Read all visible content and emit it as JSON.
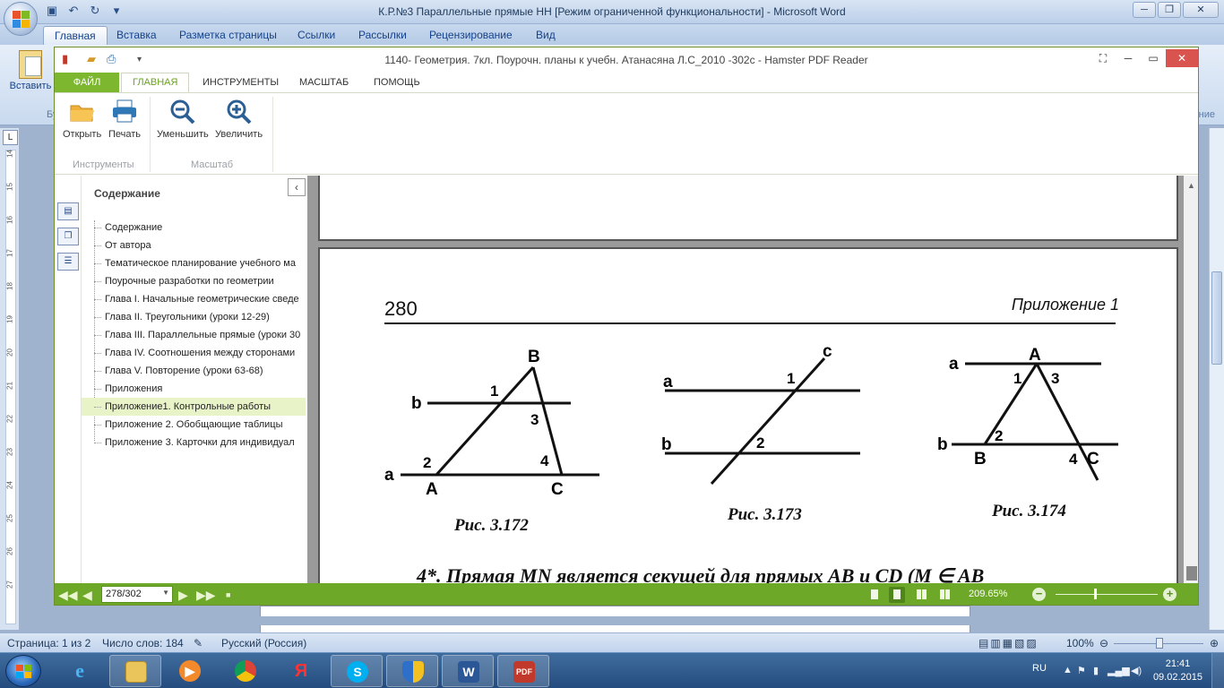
{
  "word": {
    "title": "К.Р.№3 Параллельные прямые НН [Режим ограниченной функциональности] - Microsoft Word",
    "tabs": [
      "Главная",
      "Вставка",
      "Разметка страницы",
      "Ссылки",
      "Рассылки",
      "Рецензирование",
      "Вид"
    ],
    "paste_label": "Вставить",
    "ribbon_group_left": "Бу",
    "ribbon_group_right": "ние",
    "ruler_numbers": [
      "14",
      "15",
      "16",
      "17",
      "18",
      "19",
      "20",
      "21",
      "22",
      "23",
      "24",
      "25",
      "26",
      "27"
    ],
    "status": {
      "page": "Страница: 1 из 2",
      "words": "Число слов: 184",
      "language": "Русский (Россия)",
      "zoom": "100%"
    }
  },
  "pdf": {
    "title": "1140- Геометрия. 7кл. Поурочн. планы к учебн. Атанасяна Л.С_2010 -302с - Hamster PDF Reader",
    "tabs": {
      "file": "ФАЙЛ",
      "home": "ГЛАВНАЯ",
      "tools": "ИНСТРУМЕНТЫ",
      "scale": "МАСШТАБ",
      "help": "ПОМОЩЬ"
    },
    "ribbon": {
      "open": "Открыть",
      "print": "Печать",
      "zoom_out": "Уменьшить",
      "zoom_in": "Увеличить",
      "group_tools": "Инструменты",
      "group_scale": "Масштаб"
    },
    "toc": {
      "heading": "Содержание",
      "items": [
        "Содержание",
        "От автора",
        "Тематическое планирование учебного ма",
        "Поурочные разработки по геометрии",
        "Глава I. Начальные геометрические сведе",
        "Глава II. Треугольники (уроки 12-29)",
        "Глава III. Параллельные прямые (уроки 30",
        "Глава IV. Соотношения между сторонами",
        "Глава V. Повторение (уроки 63-68)",
        "Приложения",
        "Приложение1. Контрольные работы",
        "Приложение 2. Обобщающие таблицы",
        "Приложение 3. Карточки для индивидуал"
      ],
      "selected_index": 10
    },
    "page": {
      "number": "280",
      "appendix": "Приложение 1",
      "fig1": {
        "caption": "Рис. 3.172",
        "labels": [
          "B",
          "b",
          "1",
          "3",
          "a",
          "2",
          "4",
          "A",
          "C"
        ]
      },
      "fig2": {
        "caption": "Рис. 3.173",
        "labels": [
          "c",
          "a",
          "1",
          "b",
          "2"
        ]
      },
      "fig3": {
        "caption": "Рис. 3.174",
        "labels": [
          "a",
          "A",
          "1",
          "3",
          "b",
          "2",
          "B",
          "4",
          "C"
        ]
      },
      "body_start": "4*. Прямая MN является секущей для прямых AB и CD (M ∈ AB"
    },
    "bottom": {
      "page_input": "278/302",
      "zoom": "209.65%"
    }
  },
  "taskbar": {
    "apps": [
      "ie-icon",
      "explorer-icon",
      "media-player-icon",
      "chrome-icon",
      "yandex-icon",
      "skype-icon",
      "security-icon",
      "word-icon",
      "pdf-icon"
    ],
    "lang": "RU",
    "time": "21:41",
    "date": "09.02.2015"
  },
  "colors": {
    "pdf_green": "#6ea829",
    "pdf_tab_green": "#7db72f",
    "toc_selected": "#e8f4c8"
  }
}
